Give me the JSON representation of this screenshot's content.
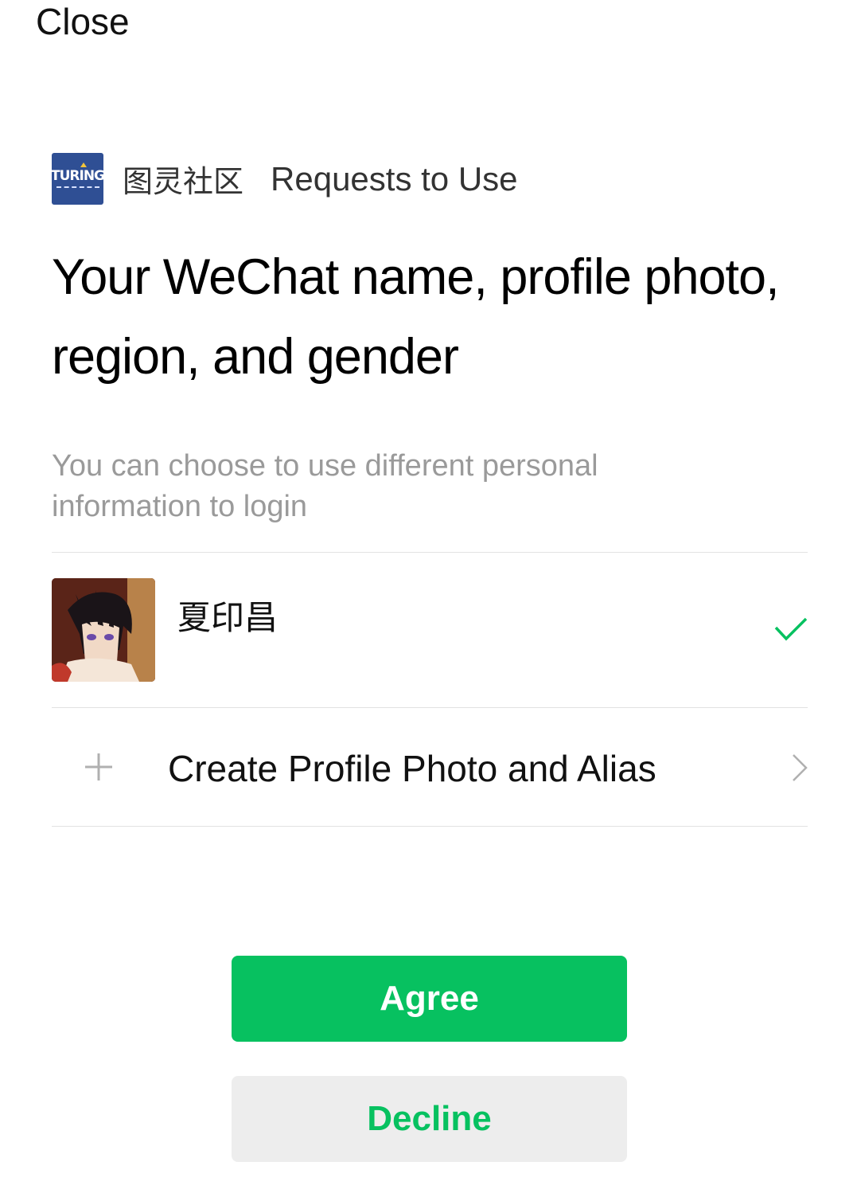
{
  "header": {
    "close_label": "Close"
  },
  "app": {
    "logo_text": "TURING",
    "name": "图灵社区",
    "request_label": "Requests to Use"
  },
  "headline": "Your WeChat name, profile photo, region, and gender",
  "subtext": "You can choose to use different personal information to login",
  "profiles": [
    {
      "name": "夏印昌",
      "selected": true,
      "icon": "checkmark-icon"
    }
  ],
  "create_option": {
    "label": "Create Profile Photo and Alias",
    "leading_icon": "plus-icon",
    "trailing_icon": "chevron-right-icon"
  },
  "actions": {
    "agree_label": "Agree",
    "decline_label": "Decline"
  },
  "colors": {
    "accent_green": "#07c160",
    "decline_bg": "#ededed",
    "logo_bg": "#2f4f94",
    "subtext_gray": "#9a9a9a"
  }
}
